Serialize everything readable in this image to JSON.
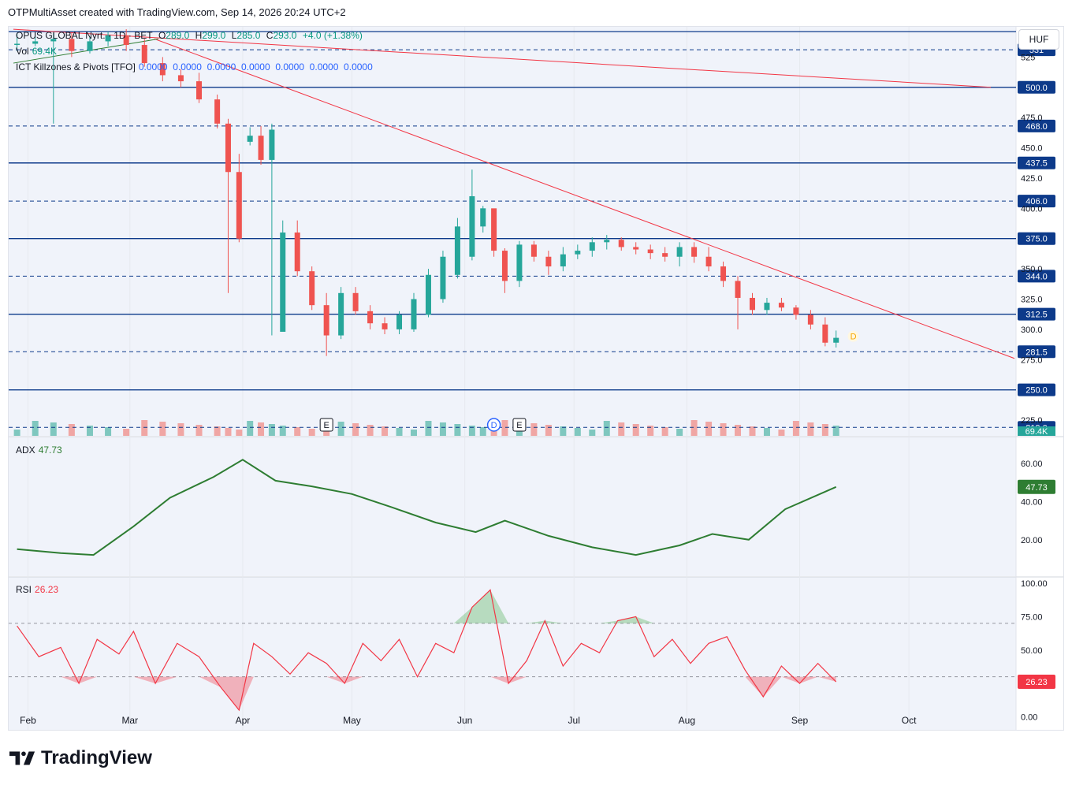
{
  "header": {
    "text": "OTPMultiAsset created with TradingView.com, Sep 14, 2026 20:24 UTC+2"
  },
  "legend": {
    "symbol": "OPUS GLOBAL Nyrt. · 1D · BET",
    "o_label": "O",
    "o": "289.0",
    "h_label": "H",
    "h": "299.0",
    "l_label": "L",
    "l": "285.0",
    "c_label": "C",
    "c": "293.0",
    "change": "+4.0 (+1.38%)",
    "vol_label": "Vol",
    "vol": "69.4K",
    "ict_label": "ICT Killzones & Pivots [TFO]",
    "ict_values": "0.0000  0.0000  0.0000  0.0000  0.0000  0.0000  0.0000"
  },
  "currency": "HUF",
  "colors": {
    "up": "#26a69a",
    "down": "#ef5350",
    "level": "#0d3a8a",
    "trend": "#f23645",
    "adx": "#2e7d32",
    "rsi": "#f23645"
  },
  "price_axis": {
    "ticks": [
      "525",
      "475.0",
      "450.0",
      "425.0",
      "400.0",
      "350.0",
      "325.0",
      "300.0",
      "275.0",
      "225.0"
    ]
  },
  "levels": [
    {
      "label": "531",
      "style": "dashed"
    },
    {
      "label": "500.0",
      "style": "solid"
    },
    {
      "label": "468.0",
      "style": "dashed"
    },
    {
      "label": "437.5",
      "style": "solid"
    },
    {
      "label": "406.0",
      "style": "dashed"
    },
    {
      "label": "375.0",
      "style": "solid"
    },
    {
      "label": "344.0",
      "style": "dashed"
    },
    {
      "label": "312.5",
      "style": "solid"
    },
    {
      "label": "281.5",
      "style": "dashed"
    },
    {
      "label": "250.0",
      "style": "solid"
    },
    {
      "label": "219.0",
      "style": "dashed"
    }
  ],
  "markers": {
    "earnings": "E",
    "dividend": "D"
  },
  "vol_badge": "69.4K",
  "adx": {
    "label": "ADX",
    "value": "47.73",
    "ticks": [
      "60.00",
      "40.00",
      "20.00"
    ]
  },
  "rsi": {
    "label": "RSI",
    "value": "26.23",
    "ticks": [
      "100.00",
      "75.00",
      "50.00",
      "0.00"
    ]
  },
  "time_axis": [
    "Feb",
    "Mar",
    "Apr",
    "May",
    "Jun",
    "Jul",
    "Aug",
    "Sep",
    "Oct"
  ],
  "brand": "TradingView",
  "chart_data": [
    {
      "type": "candlestick",
      "title": "OPUS GLOBAL Nyrt. · 1D · BET",
      "ylim": [
        212,
        550
      ],
      "x": [
        "Jan 29",
        "Feb 3",
        "Feb 8",
        "Feb 13",
        "Feb 18",
        "Feb 23",
        "Feb 28",
        "Mar 5",
        "Mar 10",
        "Mar 15",
        "Mar 20",
        "Mar 25",
        "Mar 28",
        "Mar 31",
        "Apr 3",
        "Apr 6",
        "Apr 9",
        "Apr 12",
        "Apr 16",
        "Apr 20",
        "Apr 24",
        "Apr 28",
        "May 2",
        "May 6",
        "May 10",
        "May 14",
        "May 18",
        "May 22",
        "May 26",
        "May 30",
        "Jun 3",
        "Jun 6",
        "Jun 9",
        "Jun 12",
        "Jun 16",
        "Jun 20",
        "Jun 24",
        "Jun 28",
        "Jul 2",
        "Jul 6",
        "Jul 10",
        "Jul 14",
        "Jul 18",
        "Jul 22",
        "Jul 26",
        "Jul 30",
        "Aug 3",
        "Aug 7",
        "Aug 11",
        "Aug 15",
        "Aug 19",
        "Aug 23",
        "Aug 27",
        "Aug 31",
        "Sep 4",
        "Sep 8",
        "Sep 11"
      ],
      "open": [
        535,
        536,
        538,
        540,
        530,
        538,
        543,
        535,
        520,
        510,
        505,
        490,
        470,
        430,
        455,
        460,
        440,
        298,
        380,
        348,
        320,
        295,
        330,
        315,
        305,
        300,
        300,
        312,
        325,
        345,
        360,
        385,
        400,
        365,
        340,
        370,
        360,
        352,
        362,
        365,
        372,
        374,
        368,
        366,
        363,
        360,
        368,
        360,
        352,
        340,
        326,
        316,
        322,
        318,
        312,
        304,
        289
      ],
      "close": [
        536,
        538,
        540,
        530,
        538,
        543,
        535,
        520,
        510,
        505,
        490,
        470,
        430,
        375,
        460,
        440,
        465,
        380,
        348,
        320,
        295,
        330,
        315,
        305,
        300,
        312,
        325,
        345,
        360,
        385,
        410,
        400,
        365,
        340,
        370,
        360,
        352,
        362,
        365,
        372,
        374,
        368,
        366,
        363,
        360,
        368,
        360,
        352,
        340,
        326,
        316,
        322,
        318,
        312,
        304,
        289,
        293
      ],
      "high": [
        545,
        542,
        545,
        545,
        542,
        546,
        548,
        540,
        525,
        515,
        512,
        494,
        474,
        445,
        467,
        468,
        470,
        390,
        390,
        352,
        330,
        335,
        335,
        320,
        310,
        315,
        330,
        350,
        365,
        392,
        432,
        402,
        395,
        367,
        373,
        373,
        365,
        368,
        370,
        376,
        378,
        376,
        372,
        370,
        368,
        372,
        372,
        368,
        356,
        344,
        330,
        326,
        326,
        320,
        316,
        310,
        299
      ],
      "low": [
        530,
        534,
        470,
        525,
        528,
        534,
        530,
        517,
        505,
        500,
        487,
        466,
        330,
        372,
        452,
        436,
        295,
        376,
        344,
        316,
        278,
        292,
        312,
        300,
        296,
        296,
        298,
        310,
        322,
        342,
        357,
        380,
        360,
        330,
        335,
        356,
        345,
        348,
        358,
        360,
        366,
        365,
        362,
        358,
        356,
        352,
        355,
        348,
        335,
        300,
        312,
        312,
        315,
        308,
        300,
        286,
        285
      ]
    },
    {
      "type": "line",
      "title": "ADX",
      "x": [
        "Jan 29",
        "Feb 10",
        "Feb 19",
        "Mar 2",
        "Mar 12",
        "Mar 24",
        "Apr 1",
        "Apr 10",
        "Apr 20",
        "May 1",
        "May 12",
        "May 24",
        "Jun 4",
        "Jun 12",
        "Jun 24",
        "Jul 6",
        "Jul 18",
        "Jul 30",
        "Aug 8",
        "Aug 18",
        "Aug 28",
        "Sep 11"
      ],
      "y": [
        15,
        13,
        12,
        27,
        42,
        53,
        62,
        51,
        48,
        44,
        37,
        29,
        24,
        30,
        22,
        16,
        12,
        17,
        23,
        20,
        36,
        47.73
      ],
      "ylim": [
        5,
        70
      ]
    },
    {
      "type": "line",
      "title": "RSI",
      "x": [
        "Jan 29",
        "Feb 4",
        "Feb 10",
        "Feb 15",
        "Feb 20",
        "Feb 26",
        "Mar 2",
        "Mar 8",
        "Mar 14",
        "Mar 20",
        "Mar 26",
        "Mar 31",
        "Apr 4",
        "Apr 9",
        "Apr 14",
        "Apr 19",
        "Apr 24",
        "Apr 29",
        "May 4",
        "May 9",
        "May 14",
        "May 19",
        "May 24",
        "May 29",
        "Jun 3",
        "Jun 8",
        "Jun 13",
        "Jun 18",
        "Jun 23",
        "Jun 28",
        "Jul 3",
        "Jul 8",
        "Jul 13",
        "Jul 18",
        "Jul 23",
        "Jul 28",
        "Aug 2",
        "Aug 7",
        "Aug 12",
        "Aug 17",
        "Aug 22",
        "Aug 27",
        "Sep 1",
        "Sep 6",
        "Sep 11"
      ],
      "y": [
        68,
        45,
        52,
        25,
        58,
        47,
        64,
        25,
        55,
        45,
        22,
        5,
        55,
        45,
        32,
        48,
        40,
        25,
        55,
        42,
        58,
        30,
        55,
        48,
        82,
        95,
        25,
        42,
        72,
        38,
        55,
        48,
        72,
        75,
        45,
        58,
        40,
        55,
        60,
        35,
        15,
        38,
        25,
        40,
        26.23
      ],
      "ylim": [
        -5,
        100
      ]
    },
    {
      "type": "bar",
      "title": "Vol",
      "x": [
        "Feb",
        "Mar",
        "Apr",
        "May",
        "Jun",
        "Jul",
        "Aug",
        "Sep"
      ],
      "y": [
        12,
        16,
        60,
        14,
        18,
        8,
        10,
        6
      ]
    }
  ]
}
